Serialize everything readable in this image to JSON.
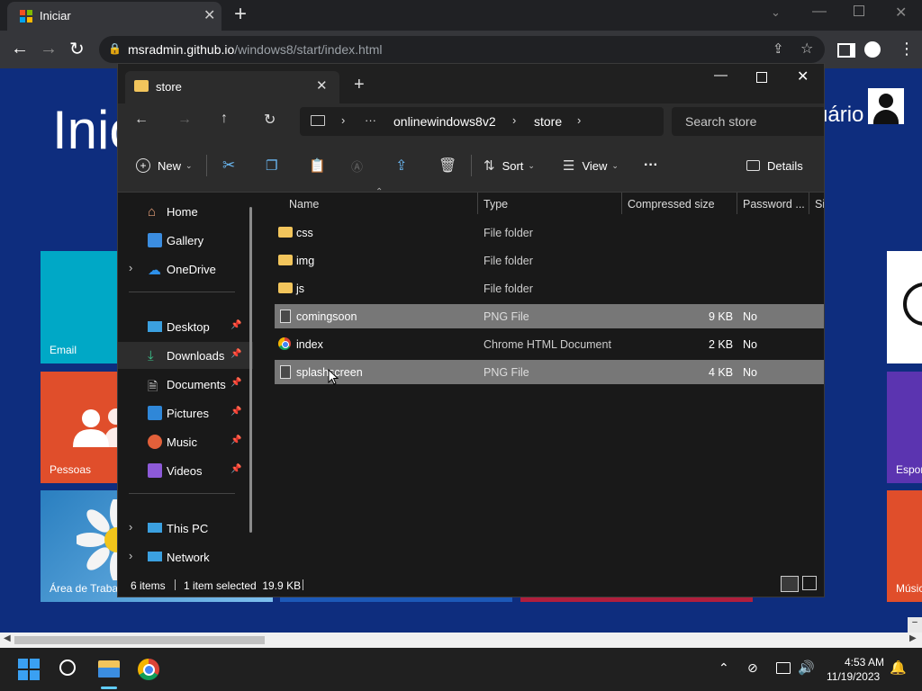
{
  "browser": {
    "tab_title": "Iniciar",
    "new_tab": "+",
    "url_host": "msradmin.github.io",
    "url_path": "/windows8/start/index.html"
  },
  "start_page": {
    "heading": "Inic",
    "user_name": "uário",
    "tiles": {
      "email": "Email",
      "people": "Pessoas",
      "desktop": "Área de Traba",
      "sports": "Espor",
      "music": "Músic"
    }
  },
  "explorer": {
    "tab_title": "store",
    "new_tab": "+",
    "address": {
      "more": "···",
      "crumbs": [
        "onlinewindows8v2",
        "store"
      ]
    },
    "search_placeholder": "Search store",
    "toolbar": {
      "new": "New",
      "sort": "Sort",
      "view": "View",
      "more": "···",
      "details": "Details"
    },
    "nav": {
      "home": "Home",
      "gallery": "Gallery",
      "onedrive": "OneDrive",
      "desktop": "Desktop",
      "downloads": "Downloads",
      "documents": "Documents",
      "pictures": "Pictures",
      "music": "Music",
      "videos": "Videos",
      "thispc": "This PC",
      "network": "Network"
    },
    "columns": {
      "name": "Name",
      "type": "Type",
      "size": "Compressed size",
      "password": "Password ...",
      "extra": "Si"
    },
    "files": [
      {
        "name": "css",
        "type": "File folder",
        "size": "",
        "password": ""
      },
      {
        "name": "img",
        "type": "File folder",
        "size": "",
        "password": ""
      },
      {
        "name": "js",
        "type": "File folder",
        "size": "",
        "password": ""
      },
      {
        "name": "comingsoon",
        "type": "PNG File",
        "size": "9 KB",
        "password": "No"
      },
      {
        "name": "index",
        "type": "Chrome HTML Document",
        "size": "2 KB",
        "password": "No"
      },
      {
        "name": "splashscreen",
        "type": "PNG File",
        "size": "4 KB",
        "password": "No"
      }
    ],
    "status": {
      "count": "6 items",
      "selected": "1 item selected  19.9 KB"
    }
  },
  "taskbar": {
    "time": "4:53 AM",
    "date": "11/19/2023"
  },
  "colors": {
    "accent": "#0078d4",
    "selection": "#777777",
    "folder": "#f2c55c"
  }
}
